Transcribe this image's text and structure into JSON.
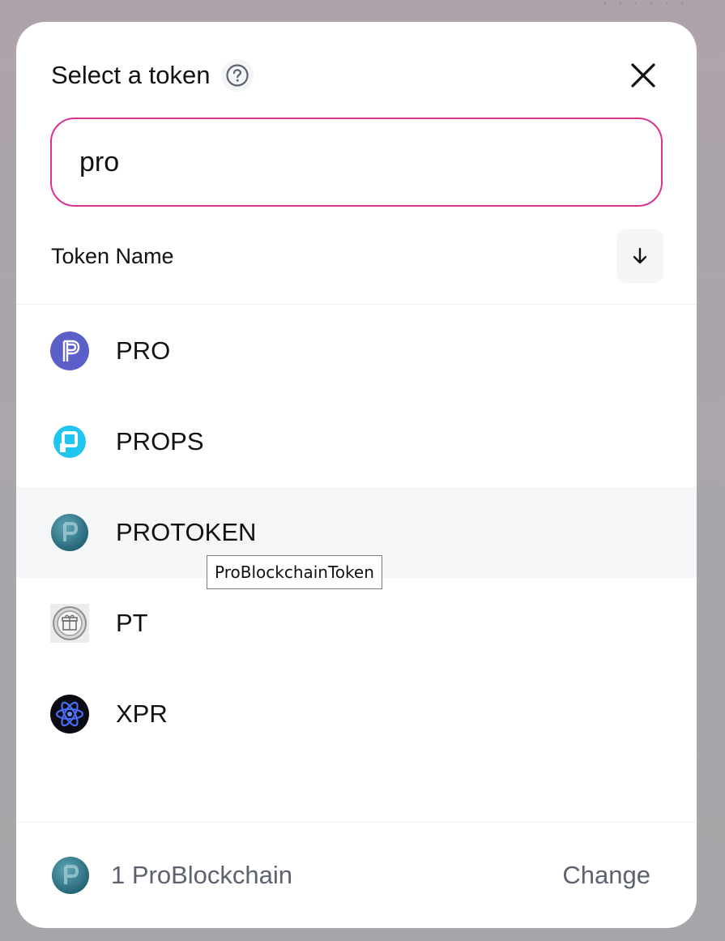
{
  "modal": {
    "title": "Select a token",
    "help_icon": "question-circle-icon",
    "close_icon": "close-x-icon"
  },
  "search": {
    "value": "pro"
  },
  "list_header": {
    "column_title": "Token Name",
    "sort_icon": "arrow-down-icon"
  },
  "tokens": [
    {
      "symbol": "PRO",
      "logo": "pro-logo-icon"
    },
    {
      "symbol": "PROPS",
      "logo": "props-logo-icon"
    },
    {
      "symbol": "PROTOKEN",
      "logo": "protoken-logo-icon"
    },
    {
      "symbol": "PT",
      "logo": "pt-gift-logo-icon"
    },
    {
      "symbol": "XPR",
      "logo": "xpr-atom-logo-icon"
    }
  ],
  "tooltip": {
    "text": "ProBlockchainToken"
  },
  "footer": {
    "amount": "1 ProBlockchain",
    "change_label": "Change"
  },
  "colors": {
    "accent_border": "#d9338f",
    "row_hover": "#f5f6f8",
    "muted_text": "#5d6170"
  }
}
